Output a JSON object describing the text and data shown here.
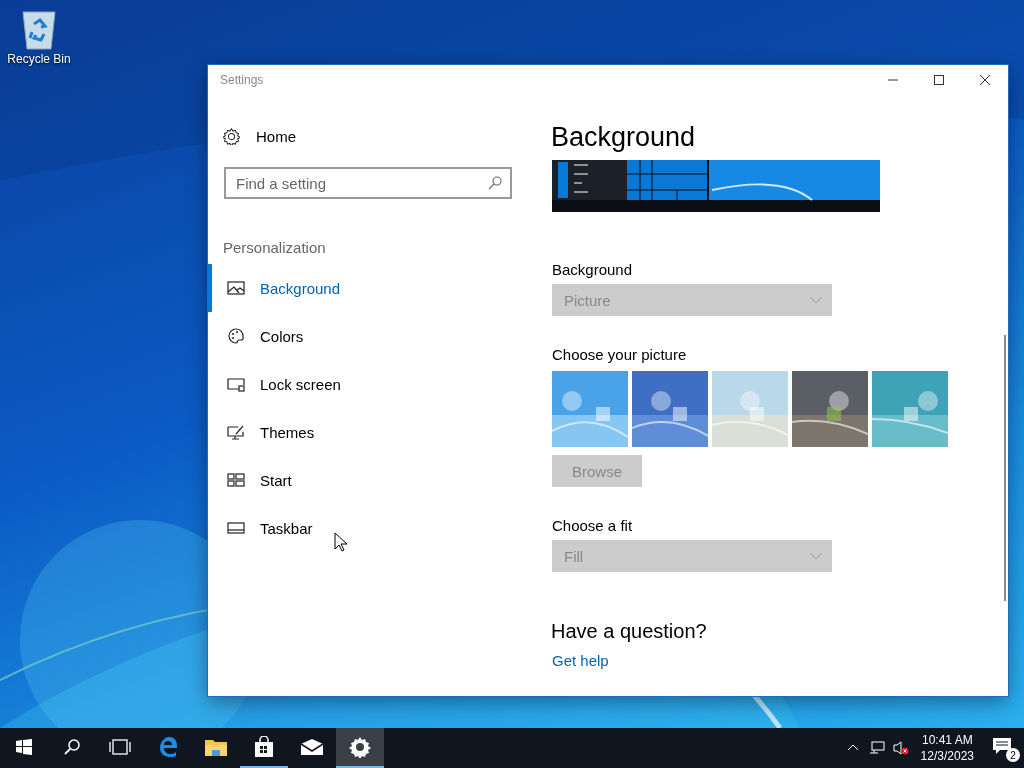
{
  "desktop_icons": [
    {
      "label": "Recycle Bin"
    }
  ],
  "window": {
    "title": "Settings",
    "sidebar": {
      "home": "Home",
      "search": {
        "placeholder": "Find a setting"
      },
      "section": "Personalization",
      "items": [
        {
          "kind": "background",
          "label": "Background",
          "selected": true
        },
        {
          "kind": "colors",
          "label": "Colors",
          "selected": false
        },
        {
          "kind": "lock",
          "label": "Lock screen",
          "selected": false
        },
        {
          "kind": "themes",
          "label": "Themes",
          "selected": false
        },
        {
          "kind": "start",
          "label": "Start",
          "selected": false
        },
        {
          "kind": "taskbar",
          "label": "Taskbar",
          "selected": false
        }
      ]
    },
    "content": {
      "title": "Background",
      "background_label": "Background",
      "background_select": {
        "value": "Picture",
        "disabled": true
      },
      "picture_label": "Choose your picture",
      "browse_button": {
        "label": "Browse",
        "disabled": true
      },
      "fit_label": "Choose a fit",
      "fit_select": {
        "value": "Fill",
        "disabled": true
      },
      "help_heading": "Have a question?",
      "help_link": "Get help"
    }
  },
  "taskbar": {
    "items": [
      {
        "kind": "start",
        "open": false,
        "selected": false
      },
      {
        "kind": "search",
        "open": false,
        "selected": false
      },
      {
        "kind": "taskview",
        "open": false,
        "selected": false
      },
      {
        "kind": "edge",
        "open": false,
        "selected": false
      },
      {
        "kind": "explorer",
        "open": false,
        "selected": false
      },
      {
        "kind": "store",
        "open": true,
        "selected": false
      },
      {
        "kind": "mail",
        "open": false,
        "selected": false
      },
      {
        "kind": "settings",
        "open": true,
        "selected": true
      }
    ],
    "time": "10:41 AM",
    "date": "12/3/2023",
    "notifications": "2"
  }
}
